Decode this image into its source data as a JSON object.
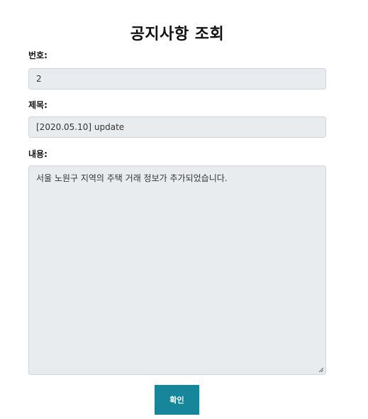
{
  "page": {
    "title": "공지사항 조회"
  },
  "form": {
    "number": {
      "label": "번호:",
      "value": "2"
    },
    "subject": {
      "label": "제목:",
      "value": "[2020.05.10] update"
    },
    "content": {
      "label": "내용:",
      "value": "서울 노원구 지역의 주택 거래 정보가 추가되었습니다."
    }
  },
  "actions": {
    "confirm_label": "확인"
  },
  "colors": {
    "button_bg": "#17869a",
    "field_bg": "#e9ecef",
    "field_border": "#ced4da"
  }
}
